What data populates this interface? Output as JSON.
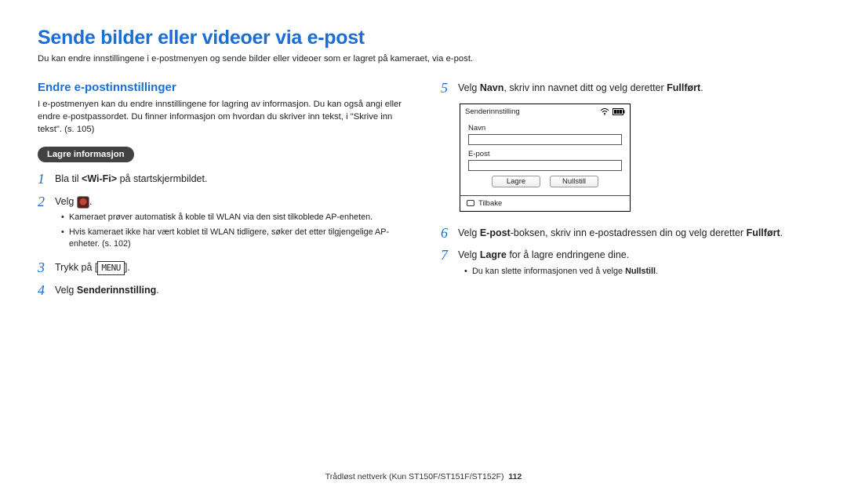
{
  "header": {
    "title": "Sende bilder eller videoer via e-post",
    "intro": "Du kan endre innstillingene i e-postmenyen og sende bilder eller videoer som er lagret på kameraet, via e-post."
  },
  "left": {
    "subhead": "Endre e-postinnstillinger",
    "subdesc": "I e-postmenyen kan du endre innstillingene for lagring av informasjon. Du kan også angi eller endre e-postpassordet. Du finner informasjon om hvordan du skriver inn tekst, i \"Skrive inn tekst\". (s. 105)",
    "pill": "Lagre informasjon",
    "steps": {
      "1": {
        "pre": "Bla til ",
        "b1": "<Wi-Fi>",
        "post": " på startskjermbildet."
      },
      "2": {
        "pre": "Velg ",
        "suffix": ".",
        "bullets": {
          "0": "Kameraet prøver automatisk å koble til WLAN via den sist tilkoblede AP-enheten.",
          "1": "Hvis kameraet ikke har vært koblet til WLAN tidligere, søker det etter tilgjengelige AP-enheter. (s. 102)"
        }
      },
      "3": {
        "pre": "Trykk på [",
        "menu": "MENU",
        "post": "]."
      },
      "4": {
        "pre": "Velg ",
        "b1": "Senderinnstilling",
        "post": "."
      }
    }
  },
  "right": {
    "steps": {
      "5": {
        "pre": "Velg ",
        "b1": "Navn",
        "mid": ", skriv inn navnet ditt og velg deretter ",
        "b2": "Fullført",
        "post": "."
      },
      "6": {
        "pre": "Velg ",
        "b1": "E-post",
        "mid": "-boksen, skriv inn e-postadressen din og velg deretter ",
        "b2": "Fullført",
        "post": "."
      },
      "7": {
        "pre": "Velg ",
        "b1": "Lagre",
        "post": " for å lagre endringene dine.",
        "bullets": {
          "0_pre": "Du kan slette informasjonen ved å velge ",
          "0_b": "Nullstill",
          "0_post": "."
        }
      }
    }
  },
  "device": {
    "title": "Senderinnstilling",
    "field1": "Navn",
    "field2": "E-post",
    "btn_save": "Lagre",
    "btn_reset": "Nullstill",
    "back": "Tilbake"
  },
  "footer": {
    "text": "Trådløst nettverk (Kun ST150F/ST151F/ST152F)",
    "page": "112"
  }
}
